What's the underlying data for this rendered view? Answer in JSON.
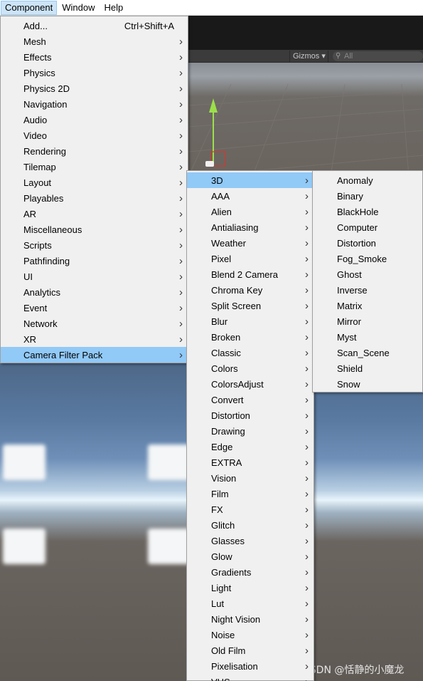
{
  "menubar": {
    "items": [
      {
        "label": "Component",
        "active": true
      },
      {
        "label": "Window",
        "active": false
      },
      {
        "label": "Help",
        "active": false
      }
    ]
  },
  "scene_toolbar": {
    "gizmos_label": "Gizmos ▾",
    "search_placeholder": "All"
  },
  "component_menu": {
    "items": [
      {
        "label": "Add...",
        "shortcut": "Ctrl+Shift+A",
        "submenu": false
      },
      {
        "label": "Mesh",
        "submenu": true
      },
      {
        "label": "Effects",
        "submenu": true
      },
      {
        "label": "Physics",
        "submenu": true
      },
      {
        "label": "Physics 2D",
        "submenu": true
      },
      {
        "label": "Navigation",
        "submenu": true
      },
      {
        "label": "Audio",
        "submenu": true
      },
      {
        "label": "Video",
        "submenu": true
      },
      {
        "label": "Rendering",
        "submenu": true
      },
      {
        "label": "Tilemap",
        "submenu": true
      },
      {
        "label": "Layout",
        "submenu": true
      },
      {
        "label": "Playables",
        "submenu": true
      },
      {
        "label": "AR",
        "submenu": true
      },
      {
        "label": "Miscellaneous",
        "submenu": true
      },
      {
        "label": "Scripts",
        "submenu": true
      },
      {
        "label": "Pathfinding",
        "submenu": true
      },
      {
        "label": "UI",
        "submenu": true
      },
      {
        "label": "Analytics",
        "submenu": true
      },
      {
        "label": "Event",
        "submenu": true
      },
      {
        "label": "Network",
        "submenu": true
      },
      {
        "label": "XR",
        "submenu": true
      },
      {
        "label": "Camera Filter Pack",
        "submenu": true,
        "highlighted": true
      }
    ]
  },
  "camera_filter_menu": {
    "items": [
      "3D",
      "AAA",
      "Alien",
      "Antialiasing",
      "Weather",
      "Pixel",
      "Blend 2 Camera",
      "Chroma Key",
      "Split Screen",
      "Blur",
      "Broken",
      "Classic",
      "Colors",
      "ColorsAdjust",
      "Convert",
      "Distortion",
      "Drawing",
      "Edge",
      "EXTRA",
      "Vision",
      "Film",
      "FX",
      "Glitch",
      "Glasses",
      "Glow",
      "Gradients",
      "Light",
      "Lut",
      "Night Vision",
      "Noise",
      "Old Film",
      "Pixelisation",
      "VHS"
    ],
    "highlighted_index": 0
  },
  "three_d_menu": {
    "items": [
      "Anomaly",
      "Binary",
      "BlackHole",
      "Computer",
      "Distortion",
      "Fog_Smoke",
      "Ghost",
      "Inverse",
      "Matrix",
      "Mirror",
      "Myst",
      "Scan_Scene",
      "Shield",
      "Snow"
    ]
  },
  "watermark": "CSDN @恬静的小魔龙",
  "colors": {
    "highlight": "#91c9f7",
    "menu_bg": "#f0f0f0",
    "menubar_active": "#cce4f7"
  },
  "icons": {
    "submenu_arrow": "chevron-right-icon",
    "search": "search-icon"
  }
}
